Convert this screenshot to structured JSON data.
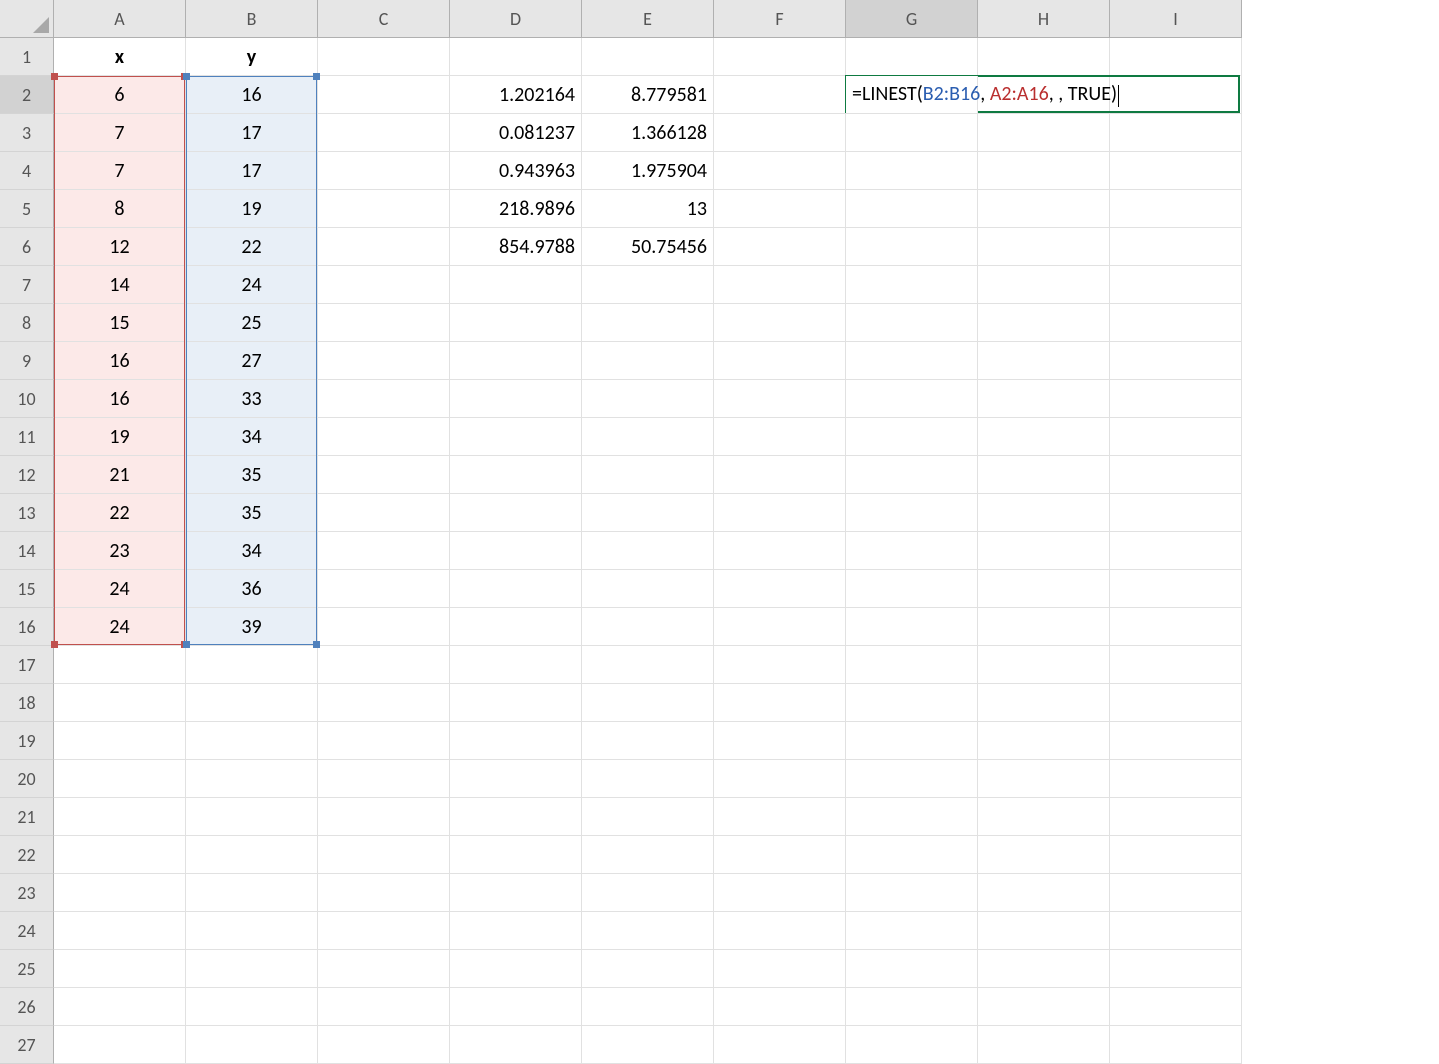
{
  "columns": [
    "A",
    "B",
    "C",
    "D",
    "E",
    "F",
    "G",
    "H",
    "I"
  ],
  "row_count": 27,
  "headers": {
    "A1": "x",
    "B1": "y"
  },
  "data_x": [
    "6",
    "7",
    "7",
    "8",
    "12",
    "14",
    "15",
    "16",
    "16",
    "19",
    "21",
    "22",
    "23",
    "24",
    "24"
  ],
  "data_y": [
    "16",
    "17",
    "17",
    "19",
    "22",
    "24",
    "25",
    "27",
    "33",
    "34",
    "35",
    "35",
    "34",
    "36",
    "39"
  ],
  "linest": {
    "D2": "1.202164",
    "E2": "8.779581",
    "D3": "0.081237",
    "E3": "1.366128",
    "D4": "0.943963",
    "E4": "1.975904",
    "D5": "218.9896",
    "E5": "13",
    "D6": "854.9788",
    "E6": "50.75456"
  },
  "formula": {
    "prefix": "=LINEST(",
    "ref1": "B2:B16",
    "sep1": ", ",
    "ref2": "A2:A16",
    "sep2": ", , ",
    "const": "TRUE",
    "suffix": ")"
  },
  "active_col": "G",
  "active_row": 2,
  "red_range": "A2:A16",
  "blue_range": "B2:B16"
}
